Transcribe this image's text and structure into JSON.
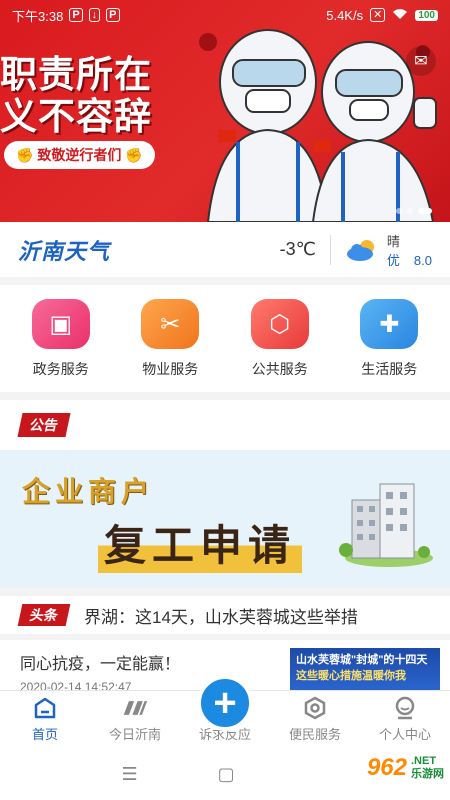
{
  "status_bar": {
    "time": "下午3:38",
    "net_speed": "5.4K/s",
    "battery": "100"
  },
  "banner": {
    "title_line1": "职责所在",
    "title_line2": "义不容辞",
    "tag": "致敬逆行者们"
  },
  "weather": {
    "title": "沂南天气",
    "temperature": "-3℃",
    "condition": "晴",
    "aqi_label": "优",
    "aqi_value": "8.0"
  },
  "services": [
    {
      "label": "政务服务",
      "icon": "phone-briefcase-icon",
      "color": "#f0467c"
    },
    {
      "label": "物业服务",
      "icon": "tools-icon",
      "color": "#f7882f"
    },
    {
      "label": "公共服务",
      "icon": "box-icon",
      "color": "#ef4a4a"
    },
    {
      "label": "生活服务",
      "icon": "medical-kit-icon",
      "color": "#3a9ae8"
    }
  ],
  "notice": {
    "tag": "公告",
    "line1": "企业商户",
    "line2": "复工申请"
  },
  "headline": {
    "tag": "头条",
    "text": "界湖：这14天，山水芙蓉城这些举措"
  },
  "news": {
    "title": "同心抗疫，一定能赢！",
    "time": "2020-02-14 14:52:47",
    "thumb_line1": "山水芙蓉城\"封城\"的十四天",
    "thumb_line2": "这些暖心措施温暖你我"
  },
  "tabs": [
    {
      "label": "首页",
      "icon": "home-icon"
    },
    {
      "label": "今日沂南",
      "icon": "today-logo-icon"
    },
    {
      "label": "诉求反应",
      "icon": "plus-icon"
    },
    {
      "label": "便民服务",
      "icon": "hexagon-icon"
    },
    {
      "label": "个人中心",
      "icon": "user-icon"
    }
  ],
  "watermark": {
    "logo": "962",
    "sub1": ".NET",
    "sub2": "乐游网"
  },
  "colors": {
    "accent_blue": "#1c63c4",
    "banner_red": "#d91a1f",
    "tag_red": "#c8161d"
  }
}
